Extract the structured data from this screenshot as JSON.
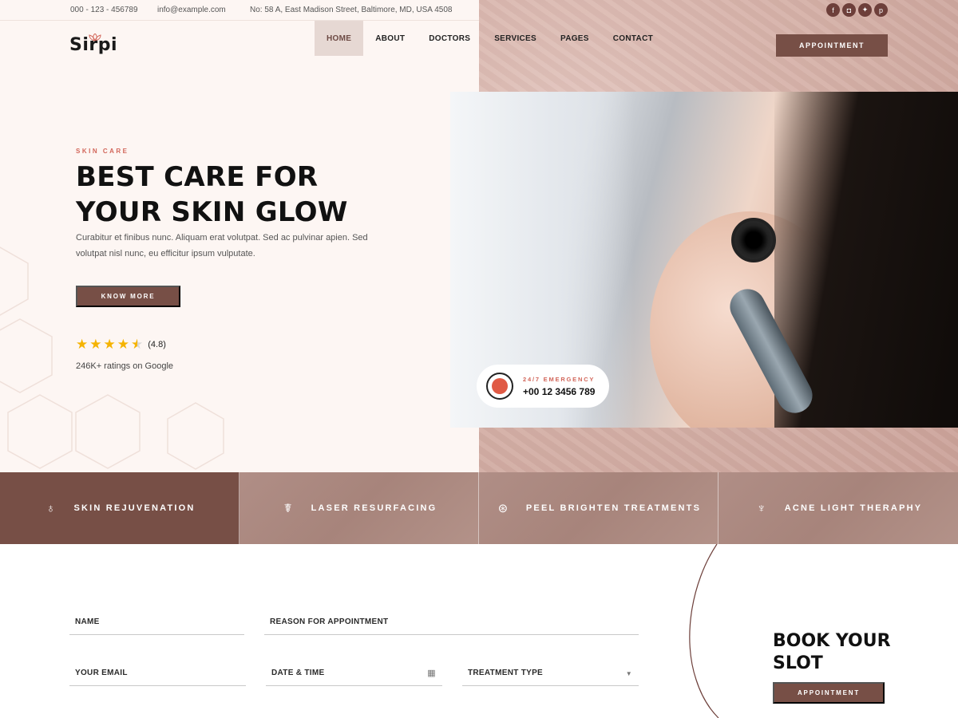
{
  "topbar": {
    "phone": "000 - 123 - 456789",
    "email": "info@example.com",
    "address": "No: 58 A, East Madison Street, Baltimore, MD, USA 4508",
    "socials": [
      {
        "name": "facebook-icon",
        "glyph": "f"
      },
      {
        "name": "instagram-icon",
        "glyph": "◘"
      },
      {
        "name": "twitter-icon",
        "glyph": "✦"
      },
      {
        "name": "pinterest-icon",
        "glyph": "p"
      }
    ]
  },
  "header": {
    "logo": "Sirpi",
    "nav": [
      "HOME",
      "ABOUT",
      "DOCTORS",
      "SERVICES",
      "PAGES",
      "CONTACT"
    ],
    "active_nav": "HOME",
    "appointment": "APPOINTMENT"
  },
  "hero": {
    "eyebrow": "SKIN CARE",
    "title_line1": "BEST CARE FOR",
    "title_line2": "YOUR SKIN GLOW",
    "description": "Curabitur et finibus nunc. Aliquam erat volutpat. Sed ac pulvinar apien. Sed volutpat nisl nunc, eu efficitur ipsum vulputate.",
    "cta": "KNOW MORE",
    "rating_value": "(4.8)",
    "rating_stars": 4.5,
    "rating_note": "246K+ ratings on Google"
  },
  "emergency": {
    "label": "24/7 EMERGENCY",
    "phone": "+00 12 3456 789"
  },
  "services": [
    {
      "label": "SKIN REJUVENATION",
      "icon": "serum-icon"
    },
    {
      "label": "LASER RESURFACING",
      "icon": "laser-icon"
    },
    {
      "label": "PEEL BRIGHTEN TREATMENTS",
      "icon": "peel-icon"
    },
    {
      "label": "ACNE LIGHT THERAPHY",
      "icon": "acne-icon"
    }
  ],
  "booking": {
    "name_label": "NAME",
    "reason_label": "REASON FOR APPOINTMENT",
    "email_label": "YOUR EMAIL",
    "date_label": "DATE & TIME",
    "treatment_label": "TREATMENT TYPE",
    "title": "BOOK YOUR SLOT",
    "button": "APPOINTMENT"
  },
  "colors": {
    "brand": "#774f46",
    "accent": "#d2665a",
    "star": "#f5b301"
  }
}
